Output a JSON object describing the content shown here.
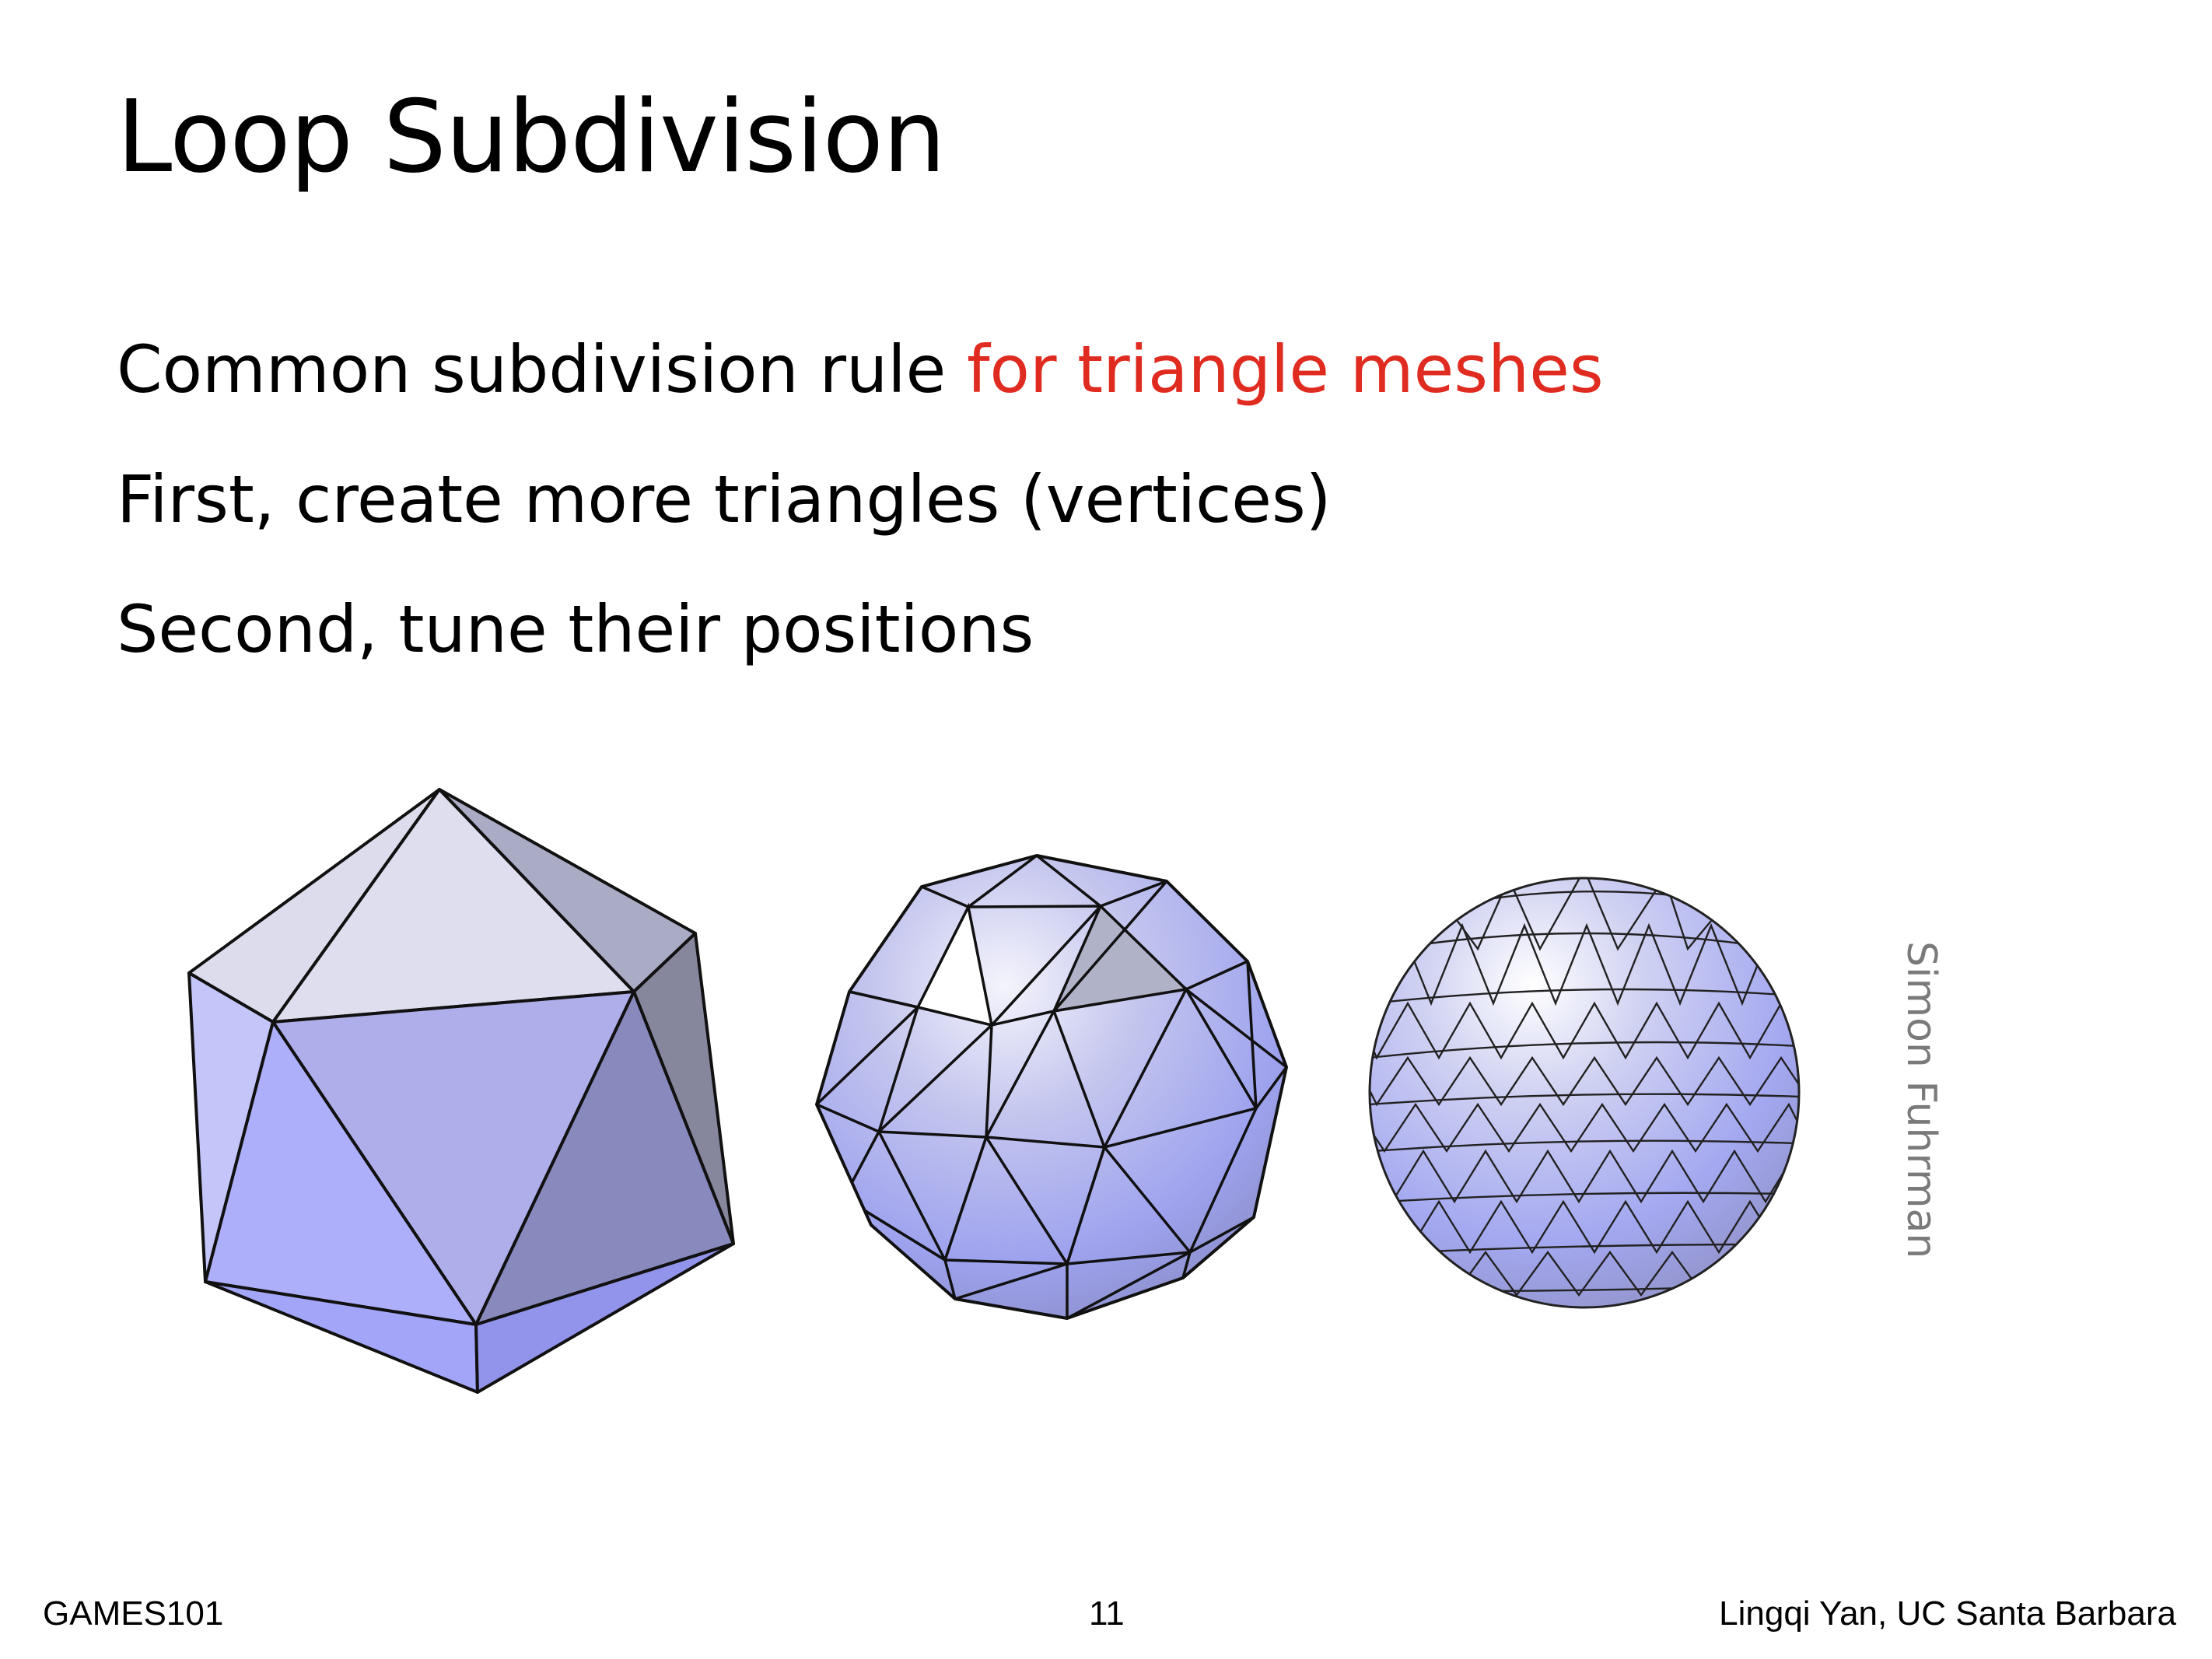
{
  "slide": {
    "title": "Loop Subdivision",
    "bullets": [
      {
        "text": "Common subdivision rule ",
        "highlight": "for triangle meshes"
      },
      {
        "text": "First, create more triangles (vertices)"
      },
      {
        "text": "Second, tune their positions"
      }
    ],
    "image_credit": "Simon Fuhrman",
    "footer": {
      "course": "GAMES101",
      "page_number": "11",
      "author": "Lingqi Yan, UC Santa Barbara"
    }
  },
  "colors": {
    "text": "#000000",
    "highlight": "#e02b20",
    "credit": "#7a7a7a",
    "mesh_light": "#dcdcf0",
    "mesh_mid": "#a8aaf0",
    "mesh_dark": "#8688b4"
  },
  "figures": [
    {
      "name": "icosahedron",
      "subdivision_level": 0
    },
    {
      "name": "subdivided-once",
      "subdivision_level": 1
    },
    {
      "name": "subdivided-twice",
      "subdivision_level": 2
    }
  ]
}
